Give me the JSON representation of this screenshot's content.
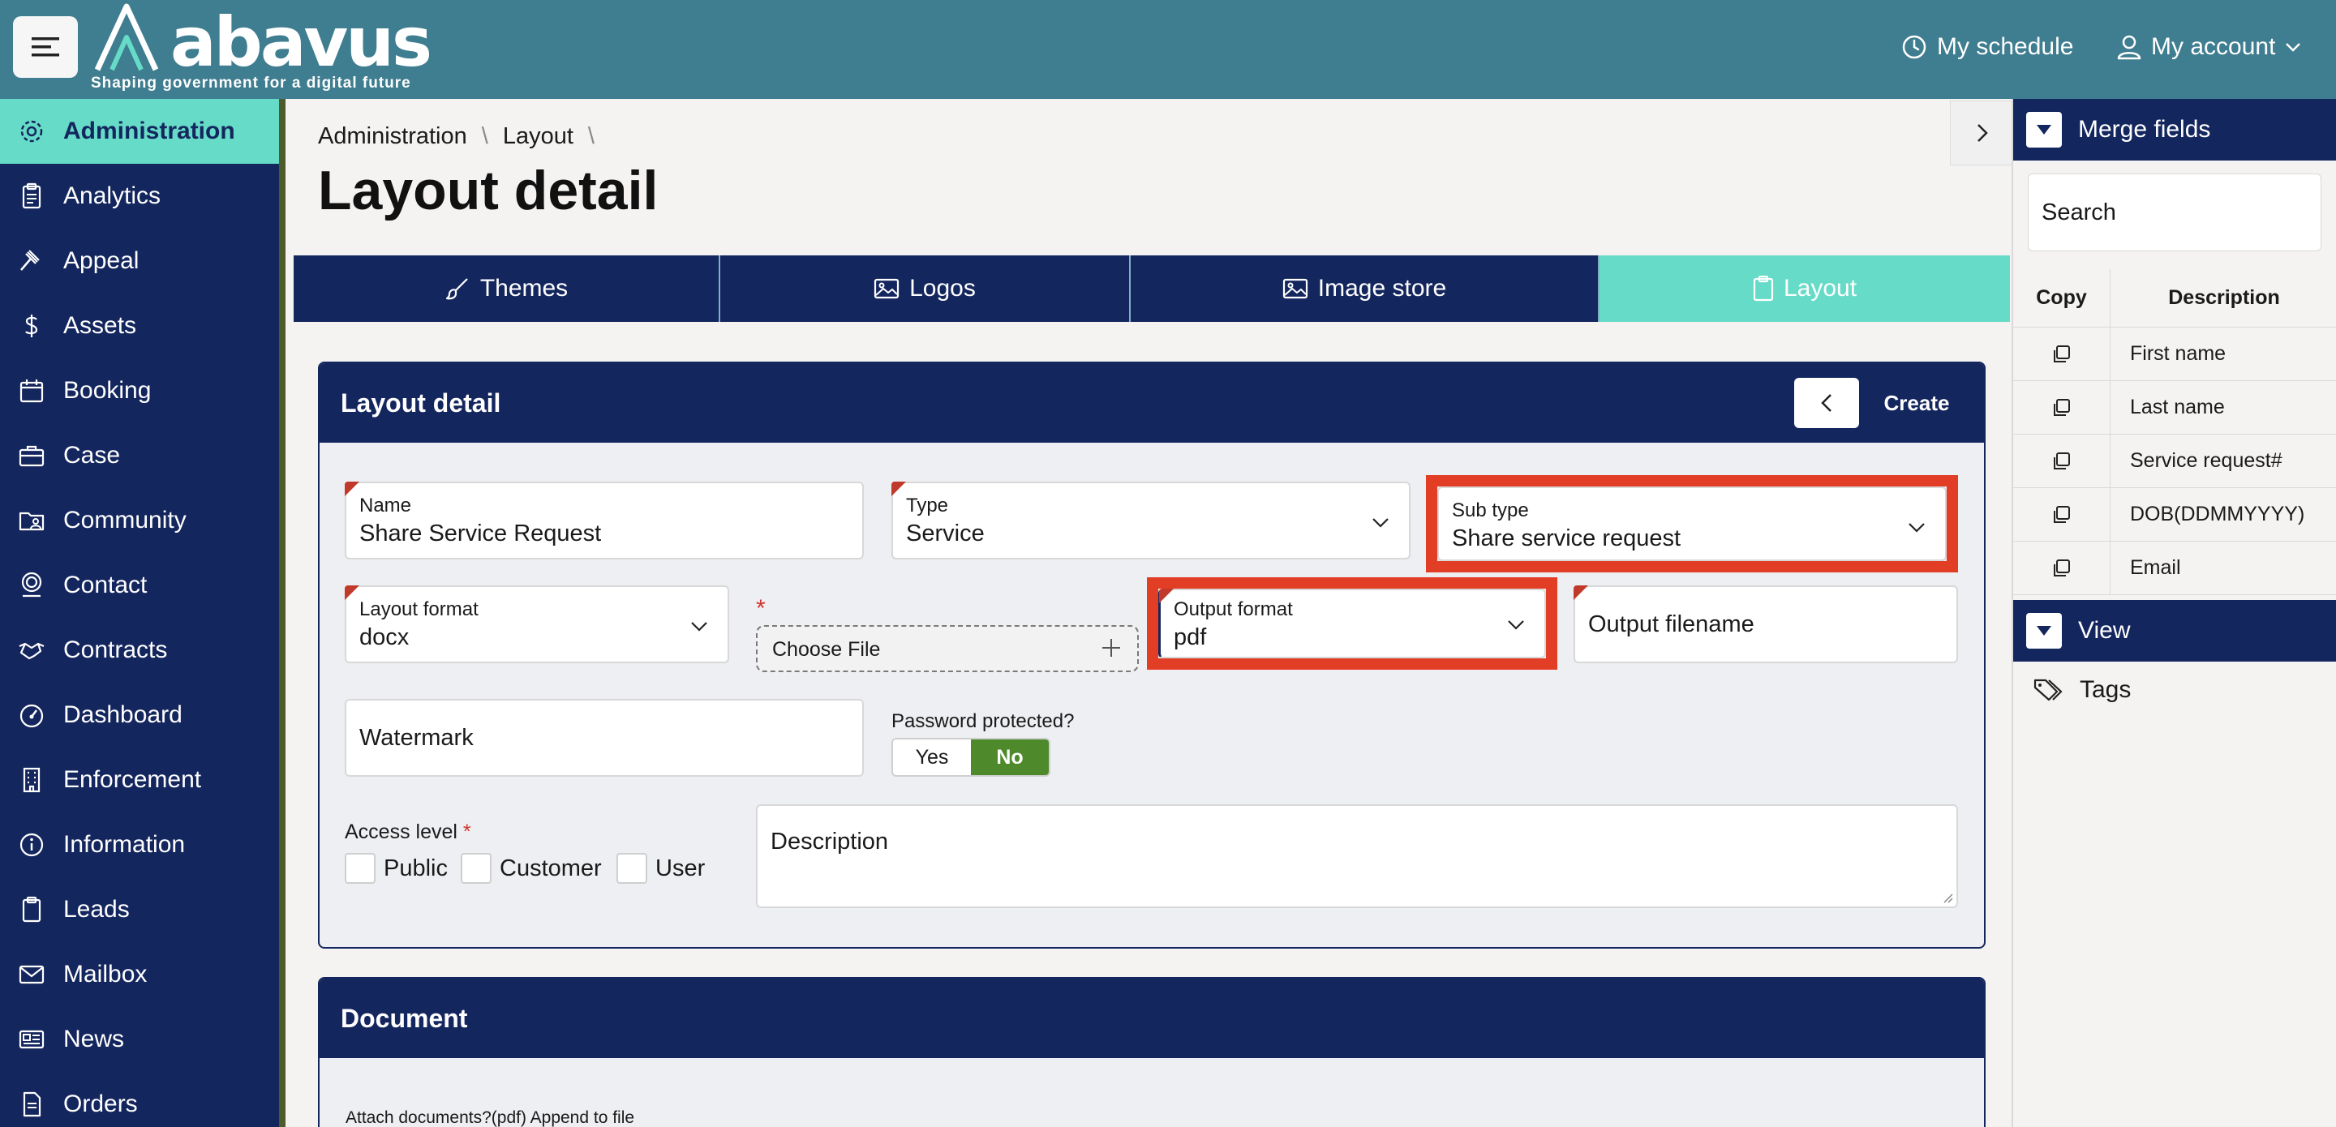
{
  "header": {
    "brand_name": "abavus",
    "brand_tagline": "Shaping government for a digital future",
    "my_schedule": "My schedule",
    "my_account": "My account"
  },
  "sidebar": {
    "items": [
      {
        "label": "Administration",
        "icon": "gear-icon",
        "active": true
      },
      {
        "label": "Analytics",
        "icon": "clipboard-icon"
      },
      {
        "label": "Appeal",
        "icon": "gavel-icon"
      },
      {
        "label": "Assets",
        "icon": "dollar-icon"
      },
      {
        "label": "Booking",
        "icon": "calendar-icon"
      },
      {
        "label": "Case",
        "icon": "briefcase-icon"
      },
      {
        "label": "Community",
        "icon": "folder-users-icon"
      },
      {
        "label": "Contact",
        "icon": "contact-icon"
      },
      {
        "label": "Contracts",
        "icon": "handshake-icon"
      },
      {
        "label": "Dashboard",
        "icon": "gauge-icon"
      },
      {
        "label": "Enforcement",
        "icon": "building-icon"
      },
      {
        "label": "Information",
        "icon": "info-icon"
      },
      {
        "label": "Leads",
        "icon": "clipboard-icon"
      },
      {
        "label": "Mailbox",
        "icon": "mail-icon"
      },
      {
        "label": "News",
        "icon": "newspaper-icon"
      },
      {
        "label": "Orders",
        "icon": "document-icon"
      }
    ]
  },
  "breadcrumb": {
    "items": [
      "Administration",
      "Layout"
    ],
    "separator": "\\"
  },
  "page_title": "Layout detail",
  "tabs": [
    {
      "label": "Themes",
      "icon": "brush-icon"
    },
    {
      "label": "Logos",
      "icon": "image-icon"
    },
    {
      "label": "Image store",
      "icon": "image-icon"
    },
    {
      "label": "Layout",
      "icon": "clipboard-icon",
      "active": true
    }
  ],
  "layout_card": {
    "title": "Layout detail",
    "create_label": "Create",
    "name": {
      "label": "Name",
      "value": "Share Service Request"
    },
    "type": {
      "label": "Type",
      "value": "Service"
    },
    "sub_type": {
      "label": "Sub type",
      "value": "Share service request"
    },
    "layout_format": {
      "label": "Layout format",
      "value": "docx"
    },
    "file": {
      "label": "Choose File",
      "required_mark": "*"
    },
    "output_format": {
      "label": "Output format",
      "value": "pdf"
    },
    "output_filename": {
      "placeholder": "Output filename"
    },
    "watermark": {
      "placeholder": "Watermark"
    },
    "password": {
      "label": "Password protected?",
      "yes": "Yes",
      "no": "No",
      "selected": "No"
    },
    "access_level": {
      "label": "Access level",
      "required_mark": "*",
      "options": [
        "Public",
        "Customer",
        "User"
      ]
    },
    "description": {
      "placeholder": "Description"
    }
  },
  "document_card": {
    "title": "Document",
    "attach_label": "Attach documents?(pdf) Append to file"
  },
  "merge_fields": {
    "title": "Merge fields",
    "search_placeholder": "Search",
    "columns": [
      "Copy",
      "Description"
    ],
    "rows": [
      "First name",
      "Last name",
      "Service request#",
      "DOB(DDMMYYYY)",
      "Email"
    ]
  },
  "view_panel": {
    "title": "View",
    "tags_label": "Tags"
  },
  "colors": {
    "topbar": "#3f7d90",
    "navy": "#14265e",
    "accent_teal": "#66dbc7",
    "highlight_red": "#e23d25",
    "toggle_green": "#4e8a2c"
  }
}
